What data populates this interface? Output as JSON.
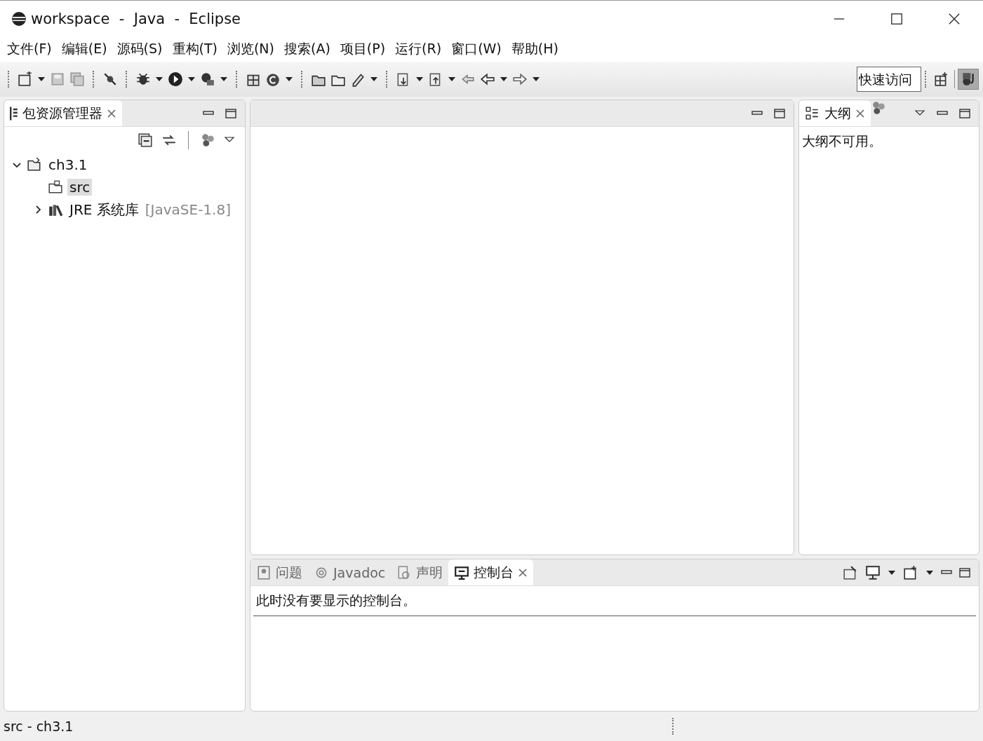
{
  "window": {
    "title": "workspace  -  Java  -  Eclipse"
  },
  "menu": [
    "文件(F)",
    "编辑(E)",
    "源码(S)",
    "重构(T)",
    "浏览(N)",
    "搜索(A)",
    "项目(P)",
    "运行(R)",
    "窗口(W)",
    "帮助(H)"
  ],
  "quick_access": {
    "placeholder": "快速访问"
  },
  "package_explorer": {
    "tab": {
      "label": "包资源管理器",
      "selected": true
    },
    "tree": [
      {
        "label": "ch3.1",
        "expanded": true,
        "selected": false,
        "children": [
          {
            "label": "src",
            "selected": true
          },
          {
            "label": "JRE 系统库",
            "decoration": "[JavaSE-1.8]",
            "expanded": false,
            "selected": false
          }
        ]
      }
    ]
  },
  "outline": {
    "tab": {
      "label": "大纲",
      "selected": true
    },
    "message": "大纲不可用。"
  },
  "bottom": {
    "tabs": [
      {
        "label": "问题",
        "selected": false
      },
      {
        "label": "Javadoc",
        "selected": false
      },
      {
        "label": "声明",
        "selected": false
      },
      {
        "label": "控制台",
        "selected": true
      }
    ],
    "message": "此时没有要显示的控制台。"
  },
  "status_bar": {
    "text": "src - ch3.1"
  }
}
